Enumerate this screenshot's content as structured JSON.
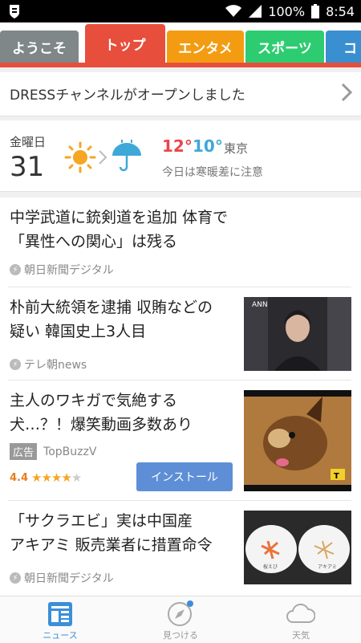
{
  "status": {
    "battery": "100%",
    "time": "8:54"
  },
  "tabs": [
    {
      "label": "ようこそ",
      "color": "#7f8788"
    },
    {
      "label": "トップ",
      "color": "#e84e3c"
    },
    {
      "label": "エンタメ",
      "color": "#f39c12"
    },
    {
      "label": "スポーツ",
      "color": "#2ecc71"
    },
    {
      "label": "コ",
      "color": "#3a8fd0"
    }
  ],
  "banner": {
    "text": "DRESSチャンネルがオープンしました"
  },
  "weather": {
    "weekday": "金曜日",
    "day": "31",
    "high": "12°",
    "low": "10°",
    "city": "東京",
    "note": "今日は寒暖差に注意",
    "high_color": "#e8464a",
    "low_color": "#3ea8d8"
  },
  "news": [
    {
      "headline1": "中学武道に銃剣道を追加 体育で",
      "headline2": "「異性への関心」は残る",
      "source": "朝日新聞デジタル"
    },
    {
      "headline1": "朴前大統領を逮捕 収賄などの",
      "headline2": "疑い 韓国史上3人目",
      "source": "テレ朝news",
      "thumb_logo": "ANN"
    },
    {
      "headline1": "主人のワキガで気絶する",
      "headline2": "犬…？！爆笑動画多数あり",
      "ad_label": "広告",
      "advertiser": "TopBuzzV",
      "rating": "4.4",
      "install": "インストール",
      "thumb_badge": "T"
    },
    {
      "headline1": "「サクラエビ」実は中国産",
      "headline2": "アキアミ 販売業者に措置命令",
      "source": "朝日新聞デジタル",
      "plate1": "桜えび",
      "plate2": "アキアミ"
    }
  ],
  "bottom_nav": [
    {
      "label": "ニュース",
      "icon": "news-icon"
    },
    {
      "label": "見つける",
      "icon": "compass-icon"
    },
    {
      "label": "天気",
      "icon": "cloud-icon"
    }
  ],
  "colors": {
    "active_tab": "#e84e3c",
    "active_nav": "#3b8fd9",
    "install_button": "#5e8fd6"
  }
}
